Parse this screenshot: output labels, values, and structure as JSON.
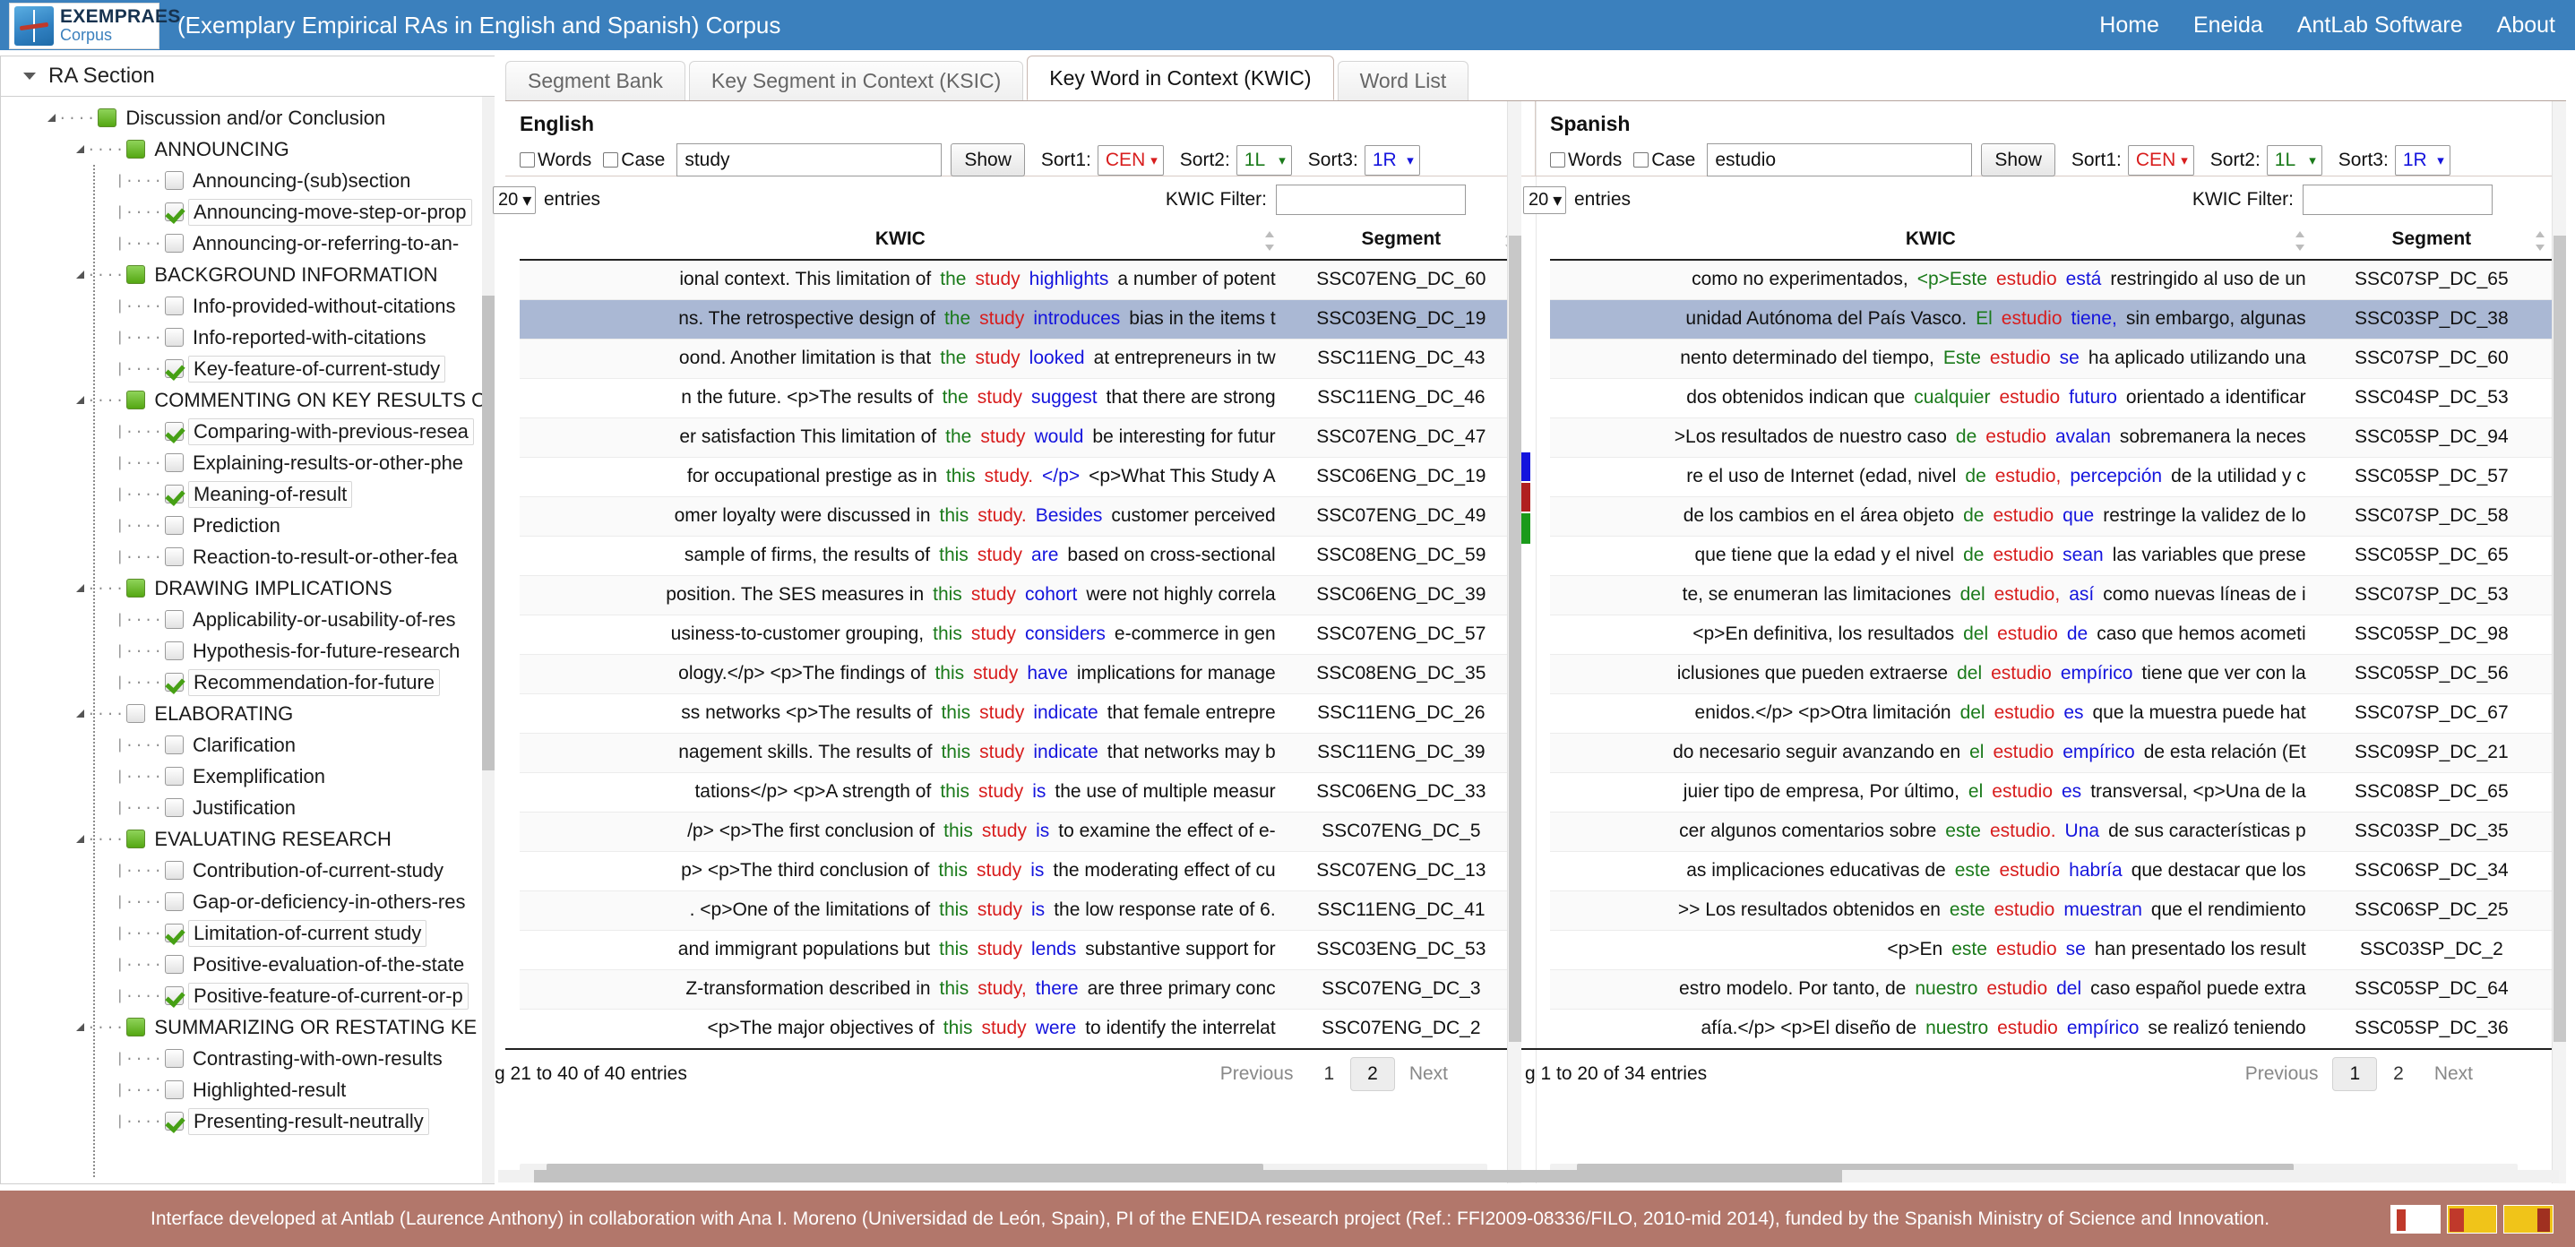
{
  "header": {
    "logo_title": "EXEMPRAES",
    "logo_sub": "Corpus",
    "title": "(Exemplary Empirical RAs in English and Spanish) Corpus",
    "nav": [
      {
        "label": "Home"
      },
      {
        "label": "Eneida"
      },
      {
        "label": "AntLab Software"
      },
      {
        "label": "About"
      }
    ]
  },
  "sidebar": {
    "title": "RA Section",
    "items": [
      {
        "label": "Discussion and/or Conclusion",
        "level": 1,
        "state": "green",
        "expander": true,
        "selected": false
      },
      {
        "label": "ANNOUNCING",
        "level": 2,
        "state": "green",
        "expander": true,
        "selected": false
      },
      {
        "label": "Announcing-(sub)section",
        "level": 3,
        "state": "empty",
        "expander": false,
        "selected": false
      },
      {
        "label": "Announcing-move-step-or-prop",
        "level": 3,
        "state": "check",
        "expander": false,
        "selected": true
      },
      {
        "label": "Announcing-or-referring-to-an-",
        "level": 3,
        "state": "empty",
        "expander": false,
        "selected": false
      },
      {
        "label": "BACKGROUND INFORMATION",
        "level": 2,
        "state": "green",
        "expander": true,
        "selected": false
      },
      {
        "label": "Info-provided-without-citations",
        "level": 3,
        "state": "empty",
        "expander": false,
        "selected": false
      },
      {
        "label": "Info-reported-with-citations",
        "level": 3,
        "state": "empty",
        "expander": false,
        "selected": false
      },
      {
        "label": "Key-feature-of-current-study",
        "level": 3,
        "state": "check",
        "expander": false,
        "selected": true
      },
      {
        "label": "COMMENTING ON KEY RESULTS O",
        "level": 2,
        "state": "green",
        "expander": true,
        "selected": false
      },
      {
        "label": "Comparing-with-previous-resea",
        "level": 3,
        "state": "check",
        "expander": false,
        "selected": true
      },
      {
        "label": "Explaining-results-or-other-phe",
        "level": 3,
        "state": "empty",
        "expander": false,
        "selected": false
      },
      {
        "label": "Meaning-of-result",
        "level": 3,
        "state": "check",
        "expander": false,
        "selected": true
      },
      {
        "label": "Prediction",
        "level": 3,
        "state": "empty",
        "expander": false,
        "selected": false
      },
      {
        "label": "Reaction-to-result-or-other-fea",
        "level": 3,
        "state": "empty",
        "expander": false,
        "selected": false
      },
      {
        "label": "DRAWING IMPLICATIONS",
        "level": 2,
        "state": "green",
        "expander": true,
        "selected": false
      },
      {
        "label": "Applicability-or-usability-of-res",
        "level": 3,
        "state": "empty",
        "expander": false,
        "selected": false
      },
      {
        "label": "Hypothesis-for-future-research",
        "level": 3,
        "state": "empty",
        "expander": false,
        "selected": false
      },
      {
        "label": "Recommendation-for-future",
        "level": 3,
        "state": "check",
        "expander": false,
        "selected": true
      },
      {
        "label": "ELABORATING",
        "level": 2,
        "state": "empty",
        "expander": true,
        "selected": false
      },
      {
        "label": "Clarification",
        "level": 3,
        "state": "empty",
        "expander": false,
        "selected": false
      },
      {
        "label": "Exemplification",
        "level": 3,
        "state": "empty",
        "expander": false,
        "selected": false
      },
      {
        "label": "Justification",
        "level": 3,
        "state": "empty",
        "expander": false,
        "selected": false
      },
      {
        "label": "EVALUATING RESEARCH",
        "level": 2,
        "state": "green",
        "expander": true,
        "selected": false
      },
      {
        "label": "Contribution-of-current-study",
        "level": 3,
        "state": "empty",
        "expander": false,
        "selected": false
      },
      {
        "label": "Gap-or-deficiency-in-others-res",
        "level": 3,
        "state": "empty",
        "expander": false,
        "selected": false
      },
      {
        "label": "Limitation-of-current study",
        "level": 3,
        "state": "check",
        "expander": false,
        "selected": true
      },
      {
        "label": "Positive-evaluation-of-the-state",
        "level": 3,
        "state": "empty",
        "expander": false,
        "selected": false
      },
      {
        "label": "Positive-feature-of-current-or-p",
        "level": 3,
        "state": "check",
        "expander": false,
        "selected": true
      },
      {
        "label": "SUMMARIZING OR RESTATING KE",
        "level": 2,
        "state": "green",
        "expander": true,
        "selected": false
      },
      {
        "label": "Contrasting-with-own-results",
        "level": 3,
        "state": "empty",
        "expander": false,
        "selected": false
      },
      {
        "label": "Highlighted-result",
        "level": 3,
        "state": "empty",
        "expander": false,
        "selected": false
      },
      {
        "label": "Presenting-result-neutrally",
        "level": 3,
        "state": "check",
        "expander": false,
        "selected": true
      }
    ]
  },
  "tabs": [
    {
      "label": "Segment Bank",
      "active": false
    },
    {
      "label": "Key Segment in Context (KSIC)",
      "active": false
    },
    {
      "label": "Key Word in Context (KWIC)",
      "active": true
    },
    {
      "label": "Word List",
      "active": false
    }
  ],
  "colors": {
    "header_bg": "#3b80bd",
    "footer_bg": "#b2776b",
    "highlight_row": "#aab8d4",
    "left_context": "#1a7a1a",
    "keyword": "#d81d1d",
    "right_context": "#1414dd"
  },
  "english": {
    "lang_label": "English",
    "words_label": "Words",
    "case_label": "Case",
    "query_value": "study",
    "query_placeholder": "",
    "show_label": "Show",
    "sort1_label": "Sort1:",
    "sort1_value": "CEN",
    "sort2_label": "Sort2:",
    "sort2_value": "1L",
    "sort3_label": "Sort3:",
    "sort3_value": "1R",
    "length_value": "20",
    "entries_label": "entries",
    "filter_label": "KWIC Filter:",
    "filter_value": "",
    "columns": {
      "kwic": "KWIC",
      "segment": "Segment"
    },
    "rows": [
      {
        "left": "ional context. This limitation of",
        "g": "the",
        "r": "study",
        "b": "highlights",
        "right": "a number of potent",
        "seg": "SSC07ENG_DC_60",
        "hl": false
      },
      {
        "left": "ns. The retrospective design of",
        "g": "the",
        "r": "study",
        "b": "introduces",
        "right": "bias in the items t",
        "seg": "SSC03ENG_DC_19",
        "hl": true
      },
      {
        "left": "oond. Another limitation is that",
        "g": "the",
        "r": "study",
        "b": "looked",
        "right": "at entrepreneurs in tw",
        "seg": "SSC11ENG_DC_43",
        "hl": false
      },
      {
        "left": "n the future. <p>The results of",
        "g": "the",
        "r": "study",
        "b": "suggest",
        "right": "that there are strong",
        "seg": "SSC11ENG_DC_46",
        "hl": false
      },
      {
        "left": "er satisfaction This limitation of",
        "g": "the",
        "r": "study",
        "b": "would",
        "right": "be interesting for futur",
        "seg": "SSC07ENG_DC_47",
        "hl": false
      },
      {
        "left": "for occupational prestige as in",
        "g": "this",
        "r": "study.",
        "b": "</p>",
        "right": "<p>What This Study A",
        "seg": "SSC06ENG_DC_19",
        "hl": false
      },
      {
        "left": "omer loyalty were discussed in",
        "g": "this",
        "r": "study.",
        "b": "Besides",
        "right": "customer perceived",
        "seg": "SSC07ENG_DC_49",
        "hl": false
      },
      {
        "left": "sample of firms, the results of",
        "g": "this",
        "r": "study",
        "b": "are",
        "right": "based on cross-sectional",
        "seg": "SSC08ENG_DC_59",
        "hl": false
      },
      {
        "left": "position. The SES measures in",
        "g": "this",
        "r": "study",
        "b": "cohort",
        "right": "were not highly correla",
        "seg": "SSC06ENG_DC_39",
        "hl": false
      },
      {
        "left": "usiness-to-customer grouping,",
        "g": "this",
        "r": "study",
        "b": "considers",
        "right": "e-commerce in gen",
        "seg": "SSC07ENG_DC_57",
        "hl": false
      },
      {
        "left": "ology.</p> <p>The findings of",
        "g": "this",
        "r": "study",
        "b": "have",
        "right": "implications for manage",
        "seg": "SSC08ENG_DC_35",
        "hl": false
      },
      {
        "left": "ss networks <p>The results of",
        "g": "this",
        "r": "study",
        "b": "indicate",
        "right": "that female entrepre",
        "seg": "SSC11ENG_DC_26",
        "hl": false
      },
      {
        "left": "nagement skills. The results of",
        "g": "this",
        "r": "study",
        "b": "indicate",
        "right": "that networks may b",
        "seg": "SSC11ENG_DC_39",
        "hl": false
      },
      {
        "left": "tations</p> <p>A strength of",
        "g": "this",
        "r": "study",
        "b": "is",
        "right": "the use of multiple measur",
        "seg": "SSC06ENG_DC_33",
        "hl": false
      },
      {
        "left": "/p> <p>The first conclusion of",
        "g": "this",
        "r": "study",
        "b": "is",
        "right": "to examine the effect of e-",
        "seg": "SSC07ENG_DC_5",
        "hl": false
      },
      {
        "left": "p> <p>The third conclusion of",
        "g": "this",
        "r": "study",
        "b": "is",
        "right": "the moderating effect of cu",
        "seg": "SSC07ENG_DC_13",
        "hl": false
      },
      {
        "left": ". <p>One of the limitations of",
        "g": "this",
        "r": "study",
        "b": "is",
        "right": "the low response rate of 6.",
        "seg": "SSC11ENG_DC_41",
        "hl": false
      },
      {
        "left": "and immigrant populations but",
        "g": "this",
        "r": "study",
        "b": "lends",
        "right": "substantive support for",
        "seg": "SSC03ENG_DC_53",
        "hl": false
      },
      {
        "left": "Z-transformation described in",
        "g": "this",
        "r": "study,",
        "b": "there",
        "right": "are three primary conc",
        "seg": "SSC07ENG_DC_3",
        "hl": false
      },
      {
        "left": "<p>The major objectives of",
        "g": "this",
        "r": "study",
        "b": "were",
        "right": "to identify the interrelat",
        "seg": "SSC07ENG_DC_2",
        "hl": false
      }
    ],
    "pager": {
      "info": "g 21 to 40 of 40 entries",
      "previous": "Previous",
      "pages": [
        "1",
        "2"
      ],
      "active_page": "2",
      "next": "Next"
    }
  },
  "spanish": {
    "lang_label": "Spanish",
    "words_label": "Words",
    "case_label": "Case",
    "query_value": "estudio",
    "query_placeholder": "",
    "show_label": "Show",
    "sort1_label": "Sort1:",
    "sort1_value": "CEN",
    "sort2_label": "Sort2:",
    "sort2_value": "1L",
    "sort3_label": "Sort3:",
    "sort3_value": "1R",
    "length_value": "20",
    "entries_label": "entries",
    "filter_label": "KWIC Filter:",
    "filter_value": "",
    "columns": {
      "kwic": "KWIC",
      "segment": "Segment"
    },
    "rows": [
      {
        "left": "como no experimentados,",
        "g": "<p>Este",
        "r": "estudio",
        "b": "está",
        "right": "restringido al uso de un",
        "seg": "SSC07SP_DC_65",
        "hl": false
      },
      {
        "left": "unidad Autónoma del País Vasco.",
        "g": "El",
        "r": "estudio",
        "b": "tiene,",
        "right": "sin embargo, algunas",
        "seg": "SSC03SP_DC_38",
        "hl": true
      },
      {
        "left": "nento determinado del tiempo,",
        "g": "Este",
        "r": "estudio",
        "b": "se",
        "right": "ha aplicado utilizando una",
        "seg": "SSC07SP_DC_60",
        "hl": false
      },
      {
        "left": "dos obtenidos indican que",
        "g": "cualquier",
        "r": "estudio",
        "b": "futuro",
        "right": "orientado a identificar",
        "seg": "SSC04SP_DC_53",
        "hl": false
      },
      {
        "left": ">Los resultados de nuestro caso",
        "g": "de",
        "r": "estudio",
        "b": "avalan",
        "right": "sobremanera la neces",
        "seg": "SSC05SP_DC_94",
        "hl": false
      },
      {
        "left": "re el uso de Internet (edad, nivel",
        "g": "de",
        "r": "estudio,",
        "b": "percepción",
        "right": "de la utilidad y c",
        "seg": "SSC05SP_DC_57",
        "hl": false
      },
      {
        "left": "de los cambios en el área objeto",
        "g": "de",
        "r": "estudio",
        "b": "que",
        "right": "restringe la validez de lo",
        "seg": "SSC07SP_DC_58",
        "hl": false
      },
      {
        "left": "que tiene que la edad y el nivel",
        "g": "de",
        "r": "estudio",
        "b": "sean",
        "right": "las variables que prese",
        "seg": "SSC05SP_DC_65",
        "hl": false
      },
      {
        "left": "te, se enumeran las limitaciones",
        "g": "del",
        "r": "estudio,",
        "b": "así",
        "right": "como nuevas líneas de i",
        "seg": "SSC07SP_DC_53",
        "hl": false
      },
      {
        "left": "<p>En definitiva, los resultados",
        "g": "del",
        "r": "estudio",
        "b": "de",
        "right": "caso que hemos acometi",
        "seg": "SSC05SP_DC_98",
        "hl": false
      },
      {
        "left": "iclusiones que pueden extraerse",
        "g": "del",
        "r": "estudio",
        "b": "empírico",
        "right": "tiene que ver con la",
        "seg": "SSC05SP_DC_56",
        "hl": false
      },
      {
        "left": "enidos.</p> <p>Otra limitación",
        "g": "del",
        "r": "estudio",
        "b": "es",
        "right": "que la muestra puede hat",
        "seg": "SSC07SP_DC_67",
        "hl": false
      },
      {
        "left": "do necesario seguir avanzando en",
        "g": "el",
        "r": "estudio",
        "b": "empírico",
        "right": "de esta relación (Et",
        "seg": "SSC09SP_DC_21",
        "hl": false
      },
      {
        "left": "juier tipo de empresa, Por último,",
        "g": "el",
        "r": "estudio",
        "b": "es",
        "right": "transversal, <p>Una de la",
        "seg": "SSC08SP_DC_65",
        "hl": false
      },
      {
        "left": "cer algunos comentarios sobre",
        "g": "este",
        "r": "estudio.",
        "b": "Una",
        "right": "de sus características p",
        "seg": "SSC03SP_DC_35",
        "hl": false
      },
      {
        "left": "as implicaciones educativas de",
        "g": "este",
        "r": "estudio",
        "b": "habría",
        "right": "que destacar que los",
        "seg": "SSC06SP_DC_34",
        "hl": false
      },
      {
        "left": ">> Los resultados obtenidos en",
        "g": "este",
        "r": "estudio",
        "b": "muestran",
        "right": "que el rendimiento",
        "seg": "SSC06SP_DC_25",
        "hl": false
      },
      {
        "left": "<p>En",
        "g": "este",
        "r": "estudio",
        "b": "se",
        "right": "han presentado los result",
        "seg": "SSC03SP_DC_2",
        "hl": false
      },
      {
        "left": "estro modelo. Por tanto, de",
        "g": "nuestro",
        "r": "estudio",
        "b": "del",
        "right": "caso español puede extra",
        "seg": "SSC05SP_DC_64",
        "hl": false
      },
      {
        "left": "afía.</p> <p>El diseño de",
        "g": "nuestro",
        "r": "estudio",
        "b": "empírico",
        "right": "se realizó teniendo",
        "seg": "SSC05SP_DC_36",
        "hl": false
      }
    ],
    "pager": {
      "info": "g 1 to 20 of 34 entries",
      "previous": "Previous",
      "pages": [
        "1",
        "2"
      ],
      "active_page": "1",
      "next": "Next"
    }
  },
  "footer": {
    "text": "Interface developed at Antlab (Laurence Anthony) in collaboration with Ana I. Moreno (Universidad de León, Spain), PI of the ENEIDA research project (Ref.: FFI2009-08336/FILO, 2010-mid 2014), funded by the Spanish Ministry of Science and Innovation."
  }
}
